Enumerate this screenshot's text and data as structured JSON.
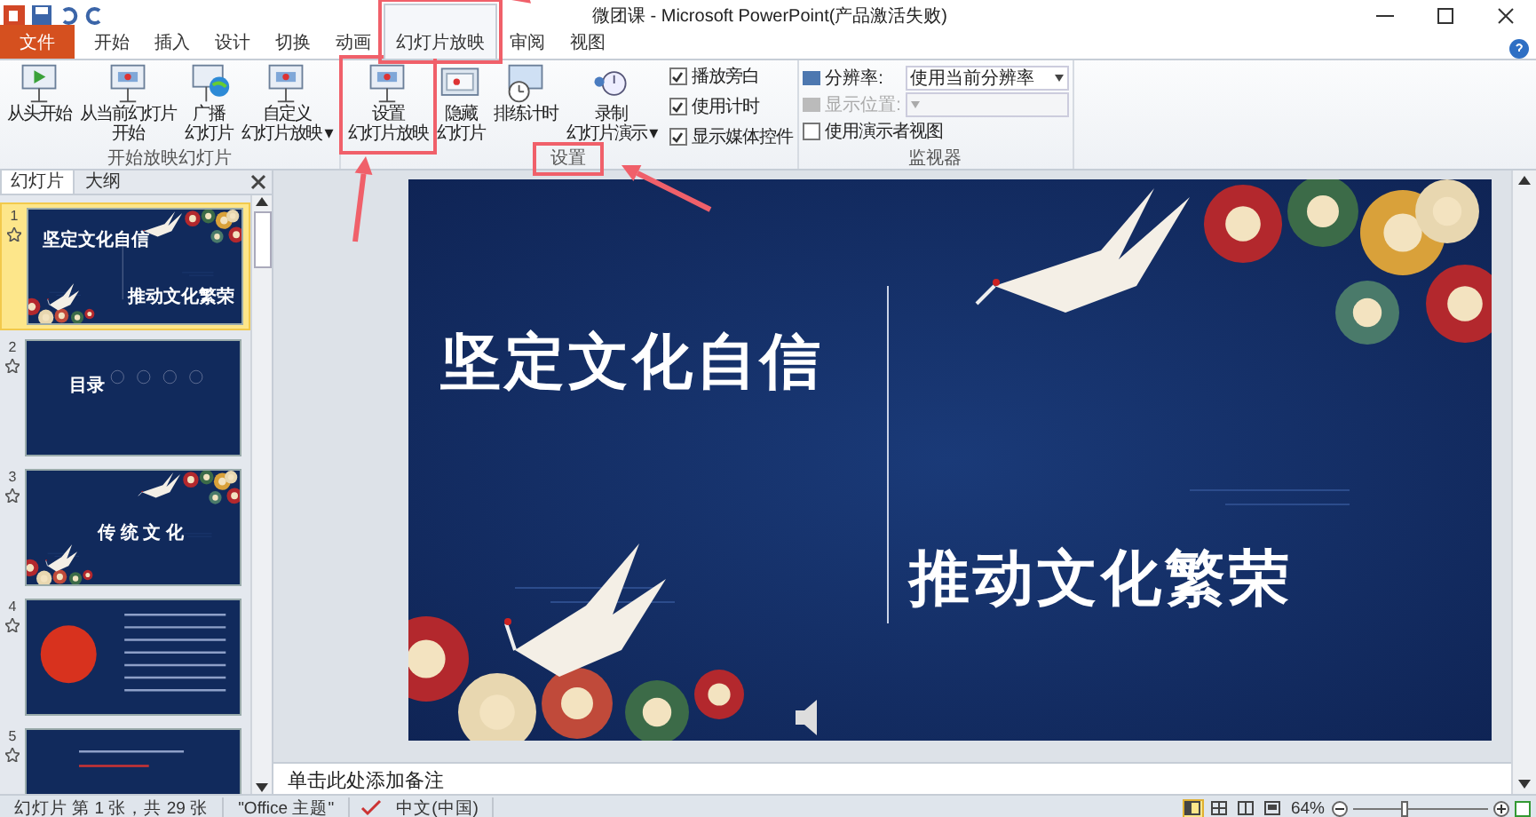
{
  "window": {
    "title": "微团课 - Microsoft PowerPoint(产品激活失败)"
  },
  "tabs": [
    {
      "label": "文件",
      "kind": "file",
      "selected": false,
      "highlighted": false
    },
    {
      "label": "开始",
      "kind": "tab",
      "selected": false,
      "highlighted": false
    },
    {
      "label": "插入",
      "kind": "tab",
      "selected": false,
      "highlighted": false
    },
    {
      "label": "设计",
      "kind": "tab",
      "selected": false,
      "highlighted": false
    },
    {
      "label": "切换",
      "kind": "tab",
      "selected": false,
      "highlighted": false
    },
    {
      "label": "动画",
      "kind": "tab",
      "selected": false,
      "highlighted": false
    },
    {
      "label": "幻灯片放映",
      "kind": "tab",
      "selected": true,
      "highlighted": true
    },
    {
      "label": "审阅",
      "kind": "tab",
      "selected": false,
      "highlighted": false
    },
    {
      "label": "视图",
      "kind": "tab",
      "selected": false,
      "highlighted": false
    }
  ],
  "ribbon_groups": [
    {
      "label": "开始放映幻灯片",
      "label_highlighted": false,
      "items": [
        {
          "kind": "big",
          "lines": [
            "从头开始"
          ],
          "highlighted": false
        },
        {
          "kind": "big",
          "lines": [
            "从当前幻灯片",
            "开始"
          ],
          "highlighted": false
        },
        {
          "kind": "big",
          "lines": [
            "广播",
            "幻灯片"
          ],
          "highlighted": false
        },
        {
          "kind": "big",
          "lines": [
            "自定义",
            "幻灯片放映 ▾"
          ],
          "highlighted": false
        }
      ]
    },
    {
      "label": "设置",
      "label_highlighted": true,
      "items": [
        {
          "kind": "big",
          "lines": [
            "设置",
            "幻灯片放映"
          ],
          "highlighted": true
        },
        {
          "kind": "big",
          "lines": [
            "隐藏",
            "幻灯片"
          ],
          "highlighted": false
        },
        {
          "kind": "big",
          "lines": [
            "排练计时"
          ],
          "highlighted": false
        },
        {
          "kind": "big",
          "lines": [
            "录制",
            "幻灯片演示 ▾"
          ],
          "highlighted": false
        },
        {
          "kind": "checks",
          "items": [
            {
              "label": "播放旁白",
              "checked": true
            },
            {
              "label": "使用计时",
              "checked": true
            },
            {
              "label": "显示媒体控件",
              "checked": true
            }
          ]
        }
      ]
    },
    {
      "label": "监视器",
      "label_highlighted": false,
      "items": [
        {
          "kind": "monitor",
          "fields": [
            {
              "label": "分辨率:",
              "value": "使用当前分辨率",
              "disabled": false
            },
            {
              "label": "显示位置:",
              "disabled": true
            }
          ],
          "check": {
            "label": "使用演示者视图",
            "checked": false
          }
        }
      ]
    }
  ],
  "pane_tabs": [
    {
      "label": "幻灯片",
      "selected": true
    },
    {
      "label": "大纲",
      "selected": false
    }
  ],
  "slides": [
    {
      "number": "1",
      "selected": true,
      "kind": "title",
      "texts": [
        "坚定文化自信",
        "推动文化繁荣"
      ]
    },
    {
      "number": "2",
      "selected": false,
      "kind": "contents",
      "texts": [
        "目录"
      ]
    },
    {
      "number": "3",
      "selected": false,
      "kind": "section",
      "texts": [
        "传 统 文 化"
      ]
    },
    {
      "number": "4",
      "selected": false,
      "kind": "sun"
    },
    {
      "number": "5",
      "selected": false,
      "kind": "plain"
    }
  ],
  "slide": {
    "title_left": "坚定文化自信",
    "title_right": "推动文化繁荣"
  },
  "notes": {
    "placeholder": "单击此处添加备注"
  },
  "status_bar": {
    "slide_info": "幻灯片 第 1 张，共 29 张",
    "theme": "\"Office 主题\"",
    "language": "中文(中国)",
    "views": [
      {
        "kind": "normal",
        "selected": true
      },
      {
        "kind": "sorter",
        "selected": false
      },
      {
        "kind": "reading",
        "selected": false
      },
      {
        "kind": "show",
        "selected": false
      }
    ],
    "zoom": "64%",
    "zoom_slider": {
      "level": 0.35
    }
  }
}
